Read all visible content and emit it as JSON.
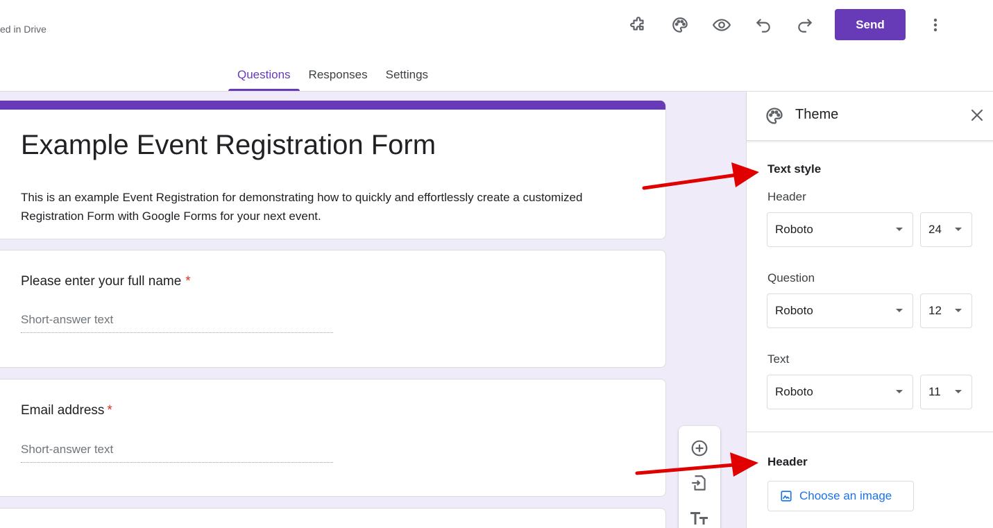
{
  "header": {
    "saved_status": "ed in Drive",
    "icons": [
      "puzzle-icon",
      "palette-icon",
      "eye-icon",
      "undo-icon",
      "redo-icon"
    ],
    "send_label": "Send",
    "more_icon": "more-vert-icon"
  },
  "tabs": [
    {
      "label": "Questions",
      "active": true
    },
    {
      "label": "Responses",
      "active": false
    },
    {
      "label": "Settings",
      "active": false
    }
  ],
  "form": {
    "title": "Example Event Registration Form",
    "description": "This is an example Event Registration for demonstrating how to quickly and effortlessly create a customized Registration Form with Google Forms for your next event.",
    "questions": [
      {
        "title": "Please enter your full name",
        "required_mark": "*",
        "placeholder": "Short-answer text"
      },
      {
        "title": "Email address",
        "required_mark": "*",
        "placeholder": "Short-answer text"
      }
    ]
  },
  "side_toolbar": [
    "add-question-icon",
    "import-questions-icon",
    "add-title-icon"
  ],
  "theme_panel": {
    "title": "Theme",
    "text_style_label": "Text style",
    "header_label": "Header",
    "header_font": "Roboto",
    "header_size": "24",
    "question_label": "Question",
    "question_font": "Roboto",
    "question_size": "12",
    "text_label": "Text",
    "text_font": "Roboto",
    "text_size": "11",
    "header_section_label": "Header",
    "choose_image_label": "Choose an image"
  },
  "colors": {
    "accent": "#673ab7",
    "canvas_bg": "#f0ebf8",
    "link_blue": "#1a73e8",
    "required_red": "#d93025",
    "annotation_arrow": "#e00000"
  }
}
